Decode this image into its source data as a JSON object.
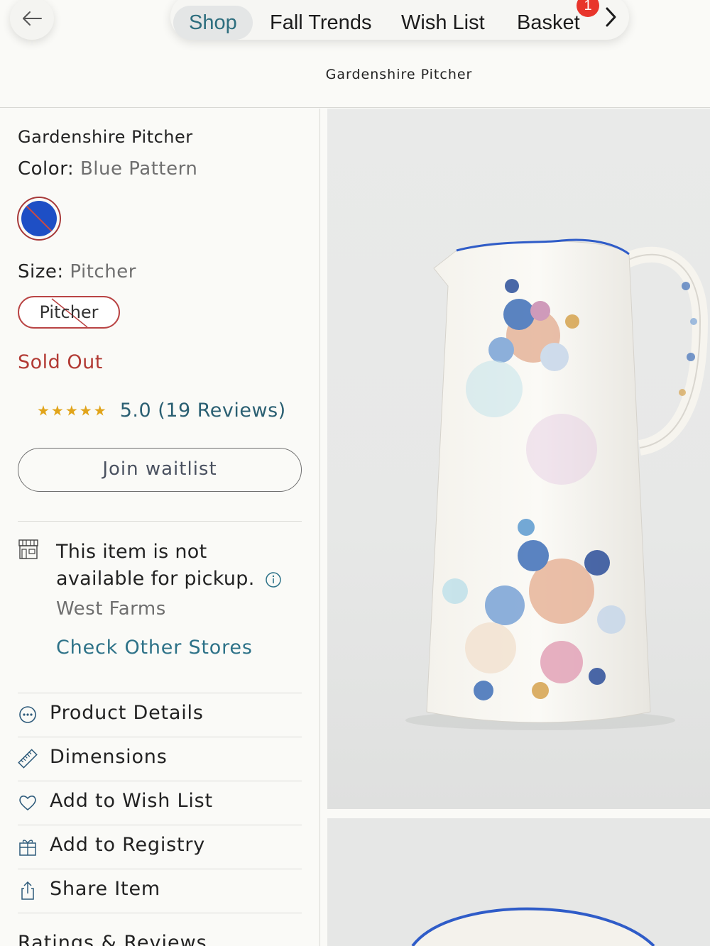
{
  "nav": {
    "back_icon": "back-arrow-icon",
    "tabs": [
      {
        "label": "Shop",
        "active": true
      },
      {
        "label": "Fall Trends",
        "active": false
      },
      {
        "label": "Wish List",
        "active": false
      },
      {
        "label": "Basket",
        "active": false
      }
    ],
    "basket_count": "1",
    "more_icon": "chevron-right-icon"
  },
  "page_title": "Gardenshire Pitcher",
  "product": {
    "name": "Gardenshire Pitcher",
    "color_label": "Color:",
    "color_value": "Blue Pattern",
    "swatch_color": "#1e4fc5",
    "size_label": "Size:",
    "size_value": "Pitcher",
    "size_option": "Pitcher",
    "status": "Sold Out",
    "status_color": "#b23a34",
    "stars": "★★★★★",
    "rating": 5.0,
    "rating_text": "5.0 (19 Reviews)",
    "waitlist_label": "Join waitlist"
  },
  "pickup": {
    "message": "This item is not available for pickup.",
    "store": "West Farms",
    "check_link": "Check Other Stores"
  },
  "menu": [
    {
      "label": "Product Details",
      "icon": "ellipsis-circle-icon"
    },
    {
      "label": "Dimensions",
      "icon": "ruler-icon"
    },
    {
      "label": "Add to Wish List",
      "icon": "heart-icon"
    },
    {
      "label": "Add to Registry",
      "icon": "gift-icon"
    },
    {
      "label": "Share Item",
      "icon": "share-icon"
    }
  ],
  "ratings_heading": "Ratings & Reviews",
  "accent_color": "#2d7288"
}
